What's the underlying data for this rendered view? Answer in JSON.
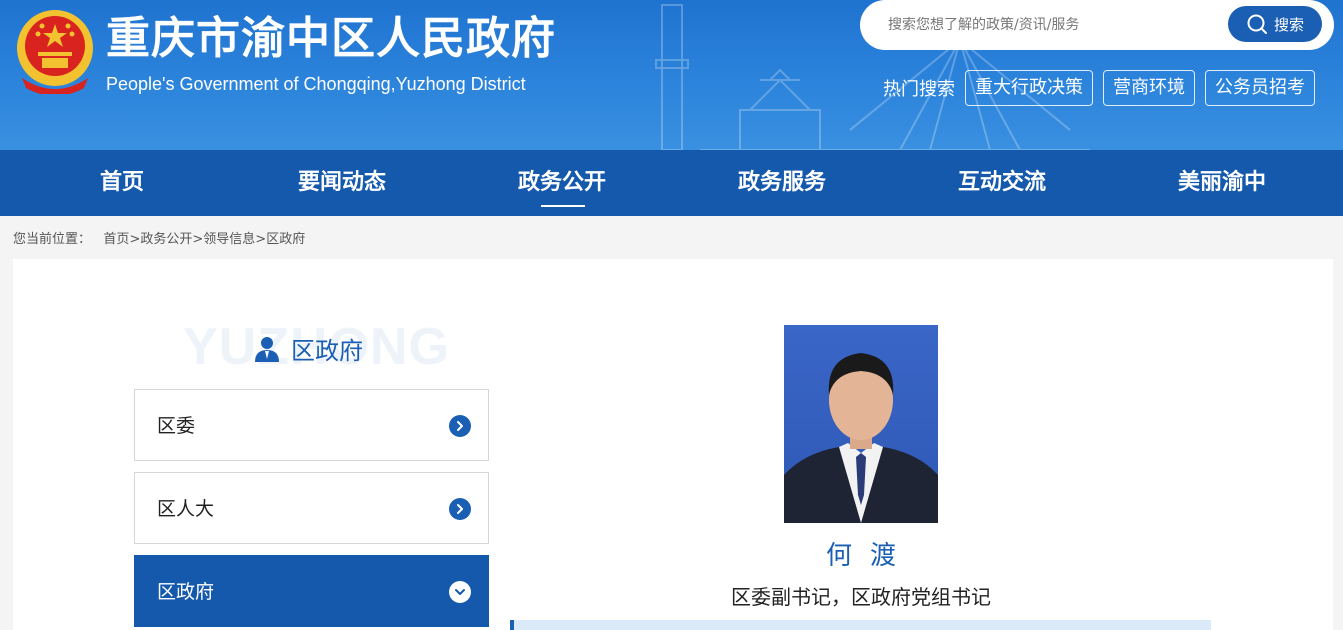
{
  "header": {
    "title": "重庆市渝中区人民政府",
    "subtitle": "People's Government of Chongqing,Yuzhong District"
  },
  "search": {
    "placeholder": "搜索您想了解的政策/资讯/服务",
    "button_label": "搜索"
  },
  "hot_search": {
    "label": "热门搜索",
    "tags": [
      "重大行政决策",
      "营商环境",
      "公务员招考"
    ]
  },
  "nav": {
    "items": [
      "首页",
      "要闻动态",
      "政务公开",
      "政务服务",
      "互动交流",
      "美丽渝中"
    ],
    "active": "政务公开"
  },
  "breadcrumb": {
    "prefix": "您当前位置：",
    "items": [
      "首页",
      "政务公开",
      "领导信息",
      "区政府"
    ],
    "separator": ">"
  },
  "sidebar": {
    "watermark": "YUZHONG",
    "title": "区政府",
    "items": [
      {
        "label": "区委",
        "active": false
      },
      {
        "label": "区人大",
        "active": false
      },
      {
        "label": "区政府",
        "active": true
      }
    ]
  },
  "profile": {
    "name": "何渡",
    "position": "区委副书记，区政府党组书记"
  },
  "colors": {
    "primary": "#1559ad",
    "accent": "#1a5fb4",
    "header_gradient": "#2d85dc"
  }
}
